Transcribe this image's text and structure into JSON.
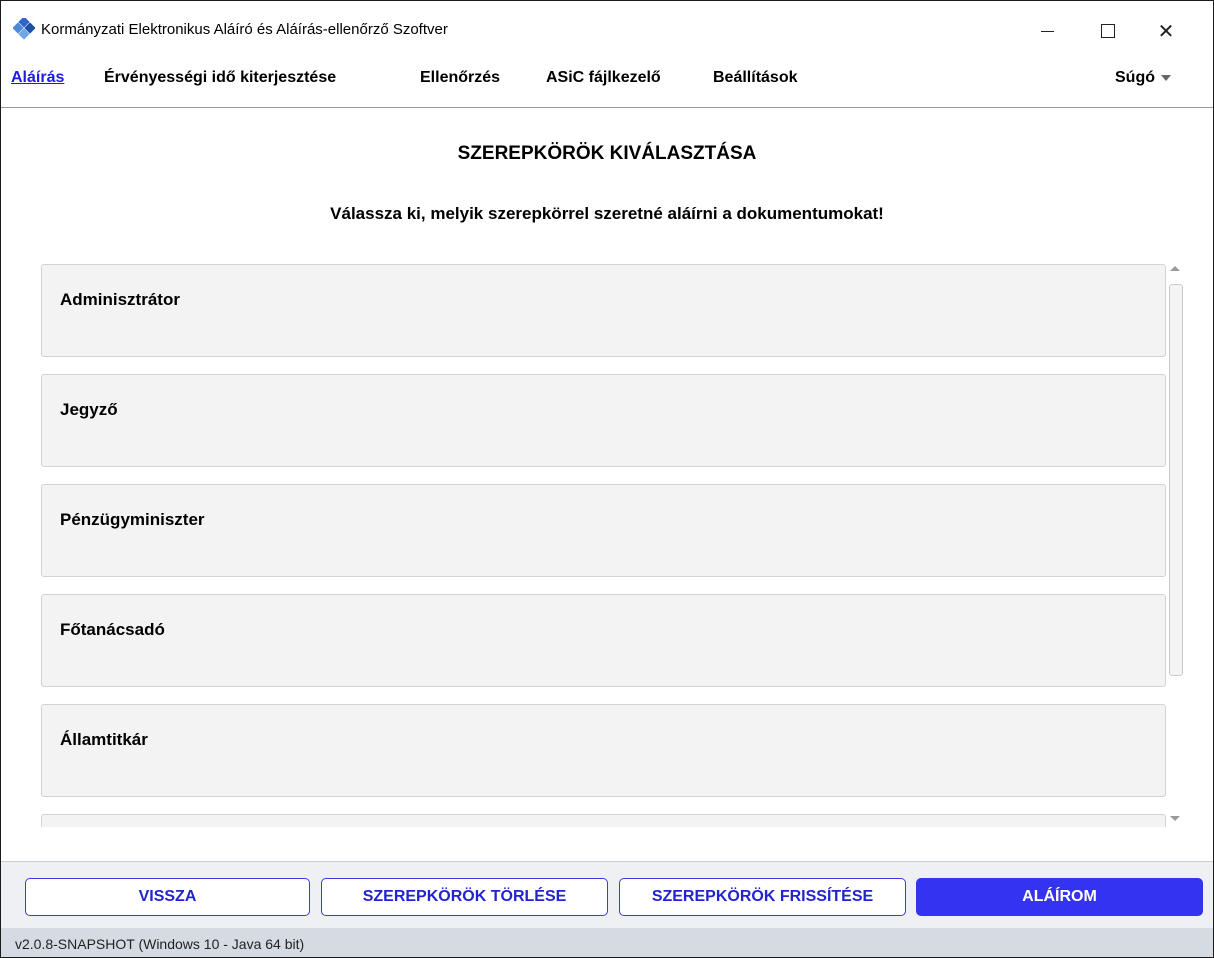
{
  "window": {
    "title": "Kormányzati Elektronikus Aláíró és Aláírás-ellenőrző Szoftver",
    "minimize_glyph": "—",
    "maximize_glyph": "□",
    "close_glyph": "✕"
  },
  "menu": {
    "items": [
      {
        "label": "Aláírás",
        "active": true
      },
      {
        "label": "Érvényességi idő kiterjesztése",
        "active": false
      },
      {
        "label": "Ellenőrzés",
        "active": false
      },
      {
        "label": "ASiC fájlkezelő",
        "active": false
      },
      {
        "label": "Beállítások",
        "active": false
      }
    ],
    "help": "Súgó"
  },
  "page": {
    "title": "SZEREPKÖRÖK KIVÁLASZTÁSA",
    "subtitle": "Válassza ki, melyik szerepkörrel szeretné aláírni a dokumentumokat!"
  },
  "roles": [
    {
      "label": "Adminisztrátor"
    },
    {
      "label": "Jegyző"
    },
    {
      "label": "Pénzügyminiszter"
    },
    {
      "label": "Főtanácsadó"
    },
    {
      "label": "Államtitkár"
    },
    {
      "label": ""
    }
  ],
  "buttons": {
    "back": "VISSZA",
    "delete_roles": "SZEREPKÖRÖK TÖRLÉSE",
    "refresh_roles": "SZEREPKÖRÖK FRISSÍTÉSE",
    "sign": "ALÁÍROM"
  },
  "status": {
    "version": "v2.0.8-SNAPSHOT (Windows 10 - Java 64 bit)"
  },
  "colors": {
    "accent": "#3434f0",
    "active_menu": "#1c1ce6",
    "card_bg": "#f3f3f3",
    "statusbar_bg": "#d6dbe3"
  }
}
